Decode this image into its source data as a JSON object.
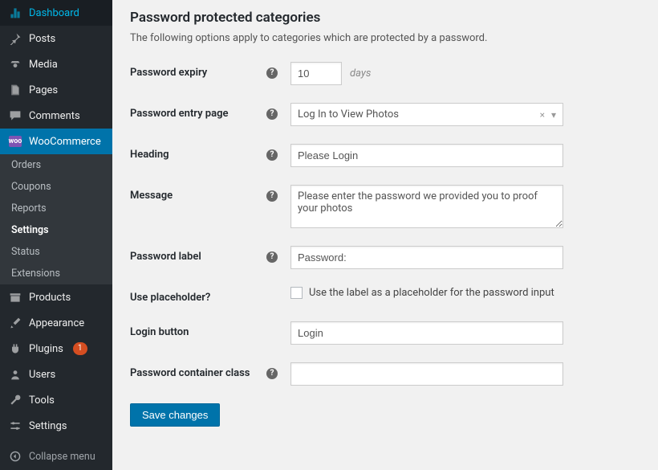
{
  "sidebar": {
    "items": [
      {
        "label": "Dashboard",
        "icon": "dashboard"
      },
      {
        "label": "Posts",
        "icon": "pin"
      },
      {
        "label": "Media",
        "icon": "media"
      },
      {
        "label": "Pages",
        "icon": "page"
      },
      {
        "label": "Comments",
        "icon": "comment"
      },
      {
        "label": "WooCommerce",
        "icon": "woo"
      },
      {
        "label": "Products",
        "icon": "archive"
      },
      {
        "label": "Appearance",
        "icon": "brush"
      },
      {
        "label": "Plugins",
        "icon": "plug",
        "badge": "1"
      },
      {
        "label": "Users",
        "icon": "user"
      },
      {
        "label": "Tools",
        "icon": "wrench"
      },
      {
        "label": "Settings",
        "icon": "sliders"
      }
    ],
    "submenu": [
      {
        "label": "Orders"
      },
      {
        "label": "Coupons"
      },
      {
        "label": "Reports"
      },
      {
        "label": "Settings",
        "current": true
      },
      {
        "label": "Status"
      },
      {
        "label": "Extensions"
      }
    ],
    "collapse": "Collapse menu"
  },
  "page": {
    "title": "Password protected categories",
    "desc": "The following options apply to categories which are protected by a password.",
    "fields": {
      "expiry": {
        "label": "Password expiry",
        "value": "10",
        "suffix": "days"
      },
      "entry": {
        "label": "Password entry page",
        "value": "Log In to View Photos"
      },
      "heading": {
        "label": "Heading",
        "value": "Please Login"
      },
      "message": {
        "label": "Message",
        "value": "Please enter the password we provided you to proof your photos"
      },
      "pwlabel": {
        "label": "Password label",
        "value": "Password:"
      },
      "placeholder": {
        "label": "Use placeholder?",
        "desc": "Use the label as a placeholder for the password input"
      },
      "loginbtn": {
        "label": "Login button",
        "value": "Login"
      },
      "container": {
        "label": "Password container class",
        "value": ""
      }
    },
    "save": "Save changes"
  }
}
